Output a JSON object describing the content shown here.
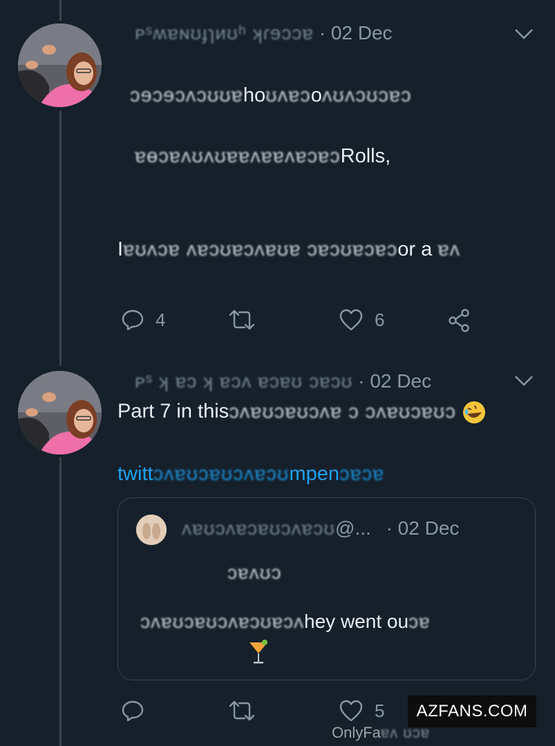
{
  "tweets": [
    {
      "header_obscured": "ᴩˢʍɐɴʊɟɿᴎʊʰ ʞɾɘɔɔɐ",
      "date": "· 02 Dec",
      "lines": [
        {
          "obscured": "ɔɘɔɘɔʌɔʊʊɐ",
          "visible": "ho",
          "obscured2": "ʊʌɐɔ",
          "visible2": "o",
          "obscured3": "ʌʊʌɔʊɔɐɔ"
        },
        {
          "obscured": "ɐɵɔɐʌʊʌʊɐɐʌɐɐʌɐɔɐɔ",
          "visible": "Rolls,"
        },
        {
          "visible": "I",
          "obscured": "ɐʊʌɔɐ ʌɐɔʊɐɔʌɐʊɐ ɔɐɔʊɐɔɐɔ",
          "visible2": "or a",
          "obscured2": "ɐʌ"
        }
      ],
      "actions": {
        "reply_count": "4",
        "retweet_count": "",
        "like_count": "6"
      }
    },
    {
      "header_obscured": "ᴩˢ ʞ ɐɔ ʞ ɐɔʌ ɐɔɐʊ ɔɐɔʊ",
      "date": "· 02 Dec",
      "text_visible": "Part 7 in this",
      "text_obscured": "ɔʌɐʊɔɐʊɔʌɐ ɔ ɔʌɐʊɔɐʊɔ",
      "link_visible": "twitt",
      "link_obscured": "ɔʌɐʊɔɐʊɔʌɐɔʊ",
      "link_visible2": "mpen",
      "link_obscured2": "ɔɐɔɐ",
      "quote": {
        "header_obscured": "ʌɐʊɔʌɐɔɐʊɔʌɐɔʊ",
        "handle_tail": "@...",
        "date": "· 02 Dec",
        "line1_obscured": "ɔɐʌʊɔ",
        "line2_obscured": "ɔʌɐʊɔɐʊɔʌɐɔʊɐɔʌ",
        "line2_visible": "hey went ou",
        "line2_obscured_tail": "ɔɐ"
      },
      "actions": {
        "reply_count": "",
        "retweet_count": "",
        "like_count": "5"
      }
    }
  ],
  "watermark": {
    "box_label": "AZFANS.COM",
    "bottom_label": "OnlyFa",
    "bottom_obscured": "ɐʌ ʊɔɐ"
  },
  "colors": {
    "background": "#15202b",
    "text": "#e9eef2",
    "muted": "#8899a6",
    "link": "#1da1f2",
    "divider": "#38444d"
  },
  "icons": [
    "reply-icon",
    "retweet-icon",
    "like-icon",
    "share-icon",
    "chevron-down-icon"
  ]
}
